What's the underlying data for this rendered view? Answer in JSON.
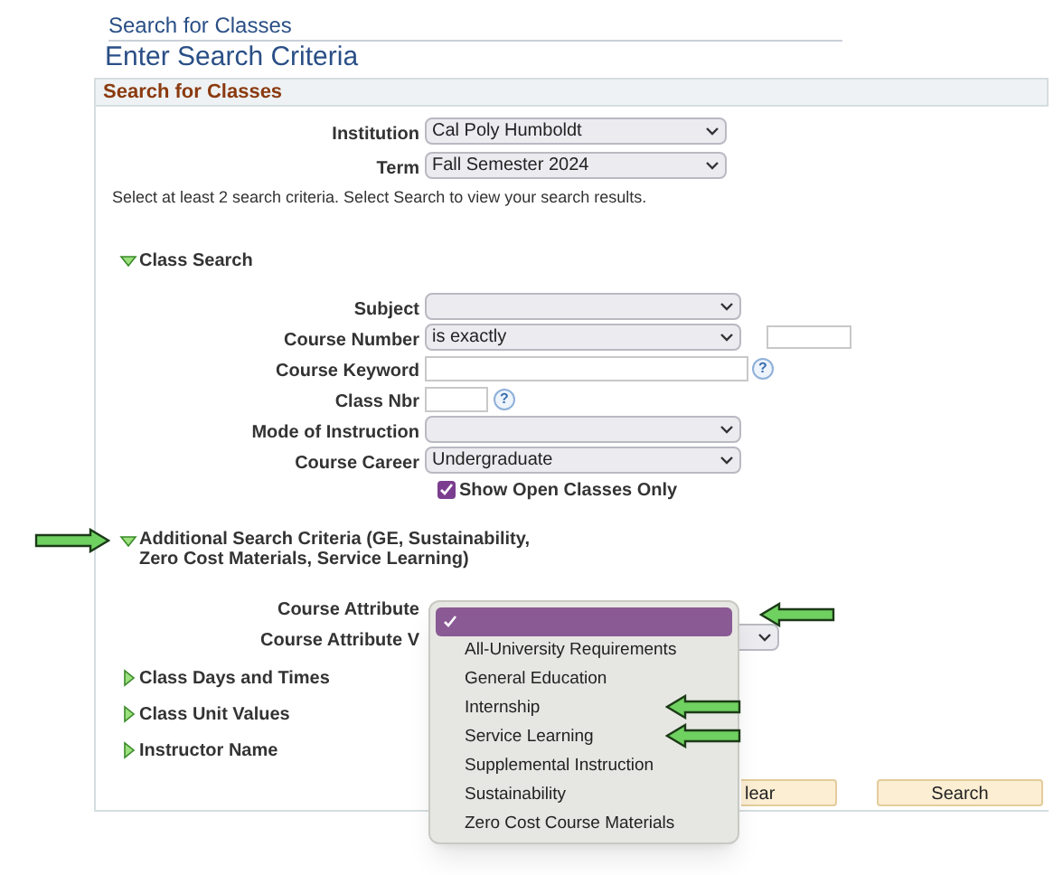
{
  "breadcrumb": "Search for Classes",
  "heading": "Enter Search Criteria",
  "panel": {
    "title": "Search for Classes",
    "fields": [
      {
        "kind": "select",
        "label": "Institution",
        "value": "Cal Poly Humboldt"
      },
      {
        "kind": "select",
        "label": "Term",
        "value": "Fall Semester 2024"
      }
    ],
    "instructions": "Select at least 2 search criteria. Select Search to view your search results.",
    "class_search": {
      "title": "Class Search",
      "expanded": true,
      "fields": [
        {
          "kind": "select",
          "label": "Subject"
        },
        {
          "kind": "select_input",
          "label": "Course Number",
          "value": "is exactly"
        },
        {
          "kind": "wide_text",
          "label": "Course Keyword",
          "help": "?"
        },
        {
          "kind": "short_text",
          "label": "Class Nbr",
          "help": "?"
        },
        {
          "kind": "select",
          "label": "Mode of Instruction"
        },
        {
          "kind": "select",
          "label": "Course Career",
          "value": "Undergraduate"
        }
      ],
      "open_only": {
        "label": "Show Open Classes Only",
        "checked": true
      }
    },
    "additional": {
      "title": "Additional Search Criteria (GE, Sustainability, Zero Cost Materials, Service Learning)",
      "expanded": true,
      "fields": [
        {
          "kind": "covered",
          "label": "Course Attribute"
        },
        {
          "kind": "covered_edge",
          "label": "Course Attribute V"
        }
      ]
    },
    "sections": [
      {
        "title": "Class Days and Times",
        "expanded": false
      },
      {
        "title": "Class Unit Values",
        "expanded": false
      },
      {
        "title": "Instructor Name",
        "expanded": false
      }
    ],
    "buttons": [
      "lear",
      "Search"
    ]
  },
  "dropdown": {
    "options": [
      {
        "selected": true
      },
      {
        "label": "All-University Requirements",
        "selected": false
      },
      {
        "label": "General Education",
        "selected": false
      },
      {
        "label": "Internship",
        "selected": false
      },
      {
        "label": "Service Learning",
        "selected": false
      },
      {
        "label": "Supplemental Instruction",
        "selected": false
      },
      {
        "label": "Sustainability",
        "selected": false
      },
      {
        "label": "Zero Cost Course Materials",
        "selected": false
      }
    ]
  }
}
